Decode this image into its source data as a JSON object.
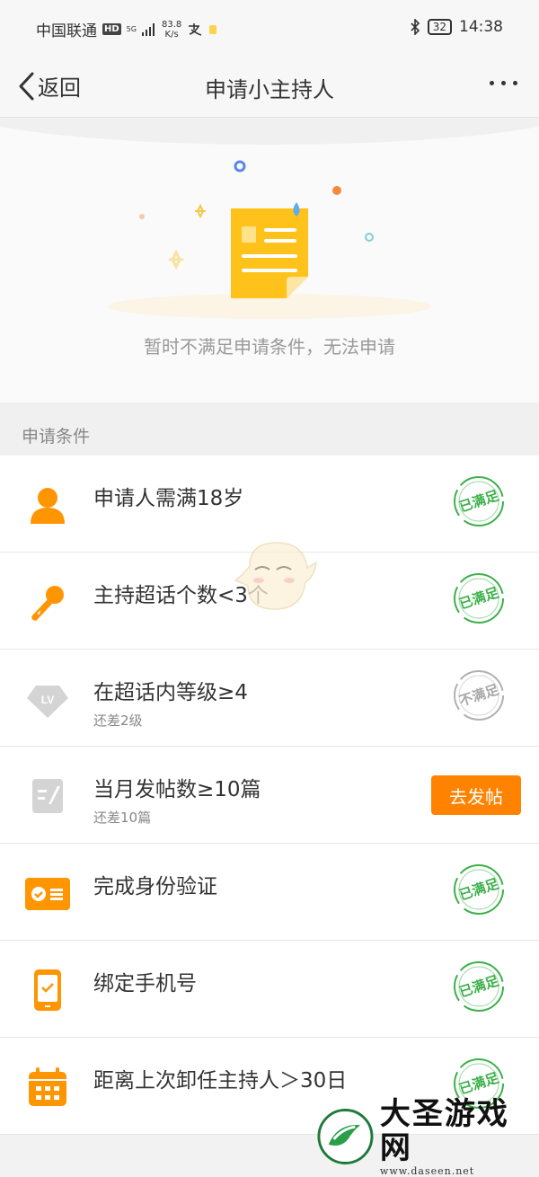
{
  "status_bar": {
    "carrier": "中国联通",
    "hd": "HD",
    "network": "5G",
    "speed_value": "83.8",
    "speed_unit": "K/s",
    "battery": "32",
    "time": "14:38"
  },
  "nav": {
    "back_label": "返回",
    "title": "申请小主持人"
  },
  "hero": {
    "message": "暂时不满足申请条件，无法申请"
  },
  "section": {
    "title": "申请条件"
  },
  "conditions": [
    {
      "title": "申请人需满18岁",
      "subtitle": "",
      "status": "已满足",
      "icon": "person-icon"
    },
    {
      "title": "主持超话个数<3个",
      "subtitle": "",
      "status": "已满足",
      "icon": "microphone-icon"
    },
    {
      "title": "在超话内等级≥4",
      "subtitle": "还差2级",
      "status": "不满足",
      "icon": "level-badge-icon"
    },
    {
      "title": "当月发帖数≥10篇",
      "subtitle": "还差10篇",
      "action": "去发帖",
      "icon": "post-icon"
    },
    {
      "title": "完成身份验证",
      "subtitle": "",
      "status": "已满足",
      "icon": "id-card-icon"
    },
    {
      "title": "绑定手机号",
      "subtitle": "",
      "status": "已满足",
      "icon": "phone-icon"
    },
    {
      "title": "距离上次卸任主持人＞30日",
      "subtitle": "",
      "status": "已满足",
      "icon": "calendar-icon"
    }
  ],
  "watermark": {
    "name": "大圣游戏网",
    "url": "www.daseen.net"
  },
  "colors": {
    "accent": "#ff8200",
    "satisfied": "#3cb04a",
    "unsatisfied": "#b0b0b0",
    "icon_active": "#ff9500",
    "icon_inactive": "#d0d0d0"
  }
}
